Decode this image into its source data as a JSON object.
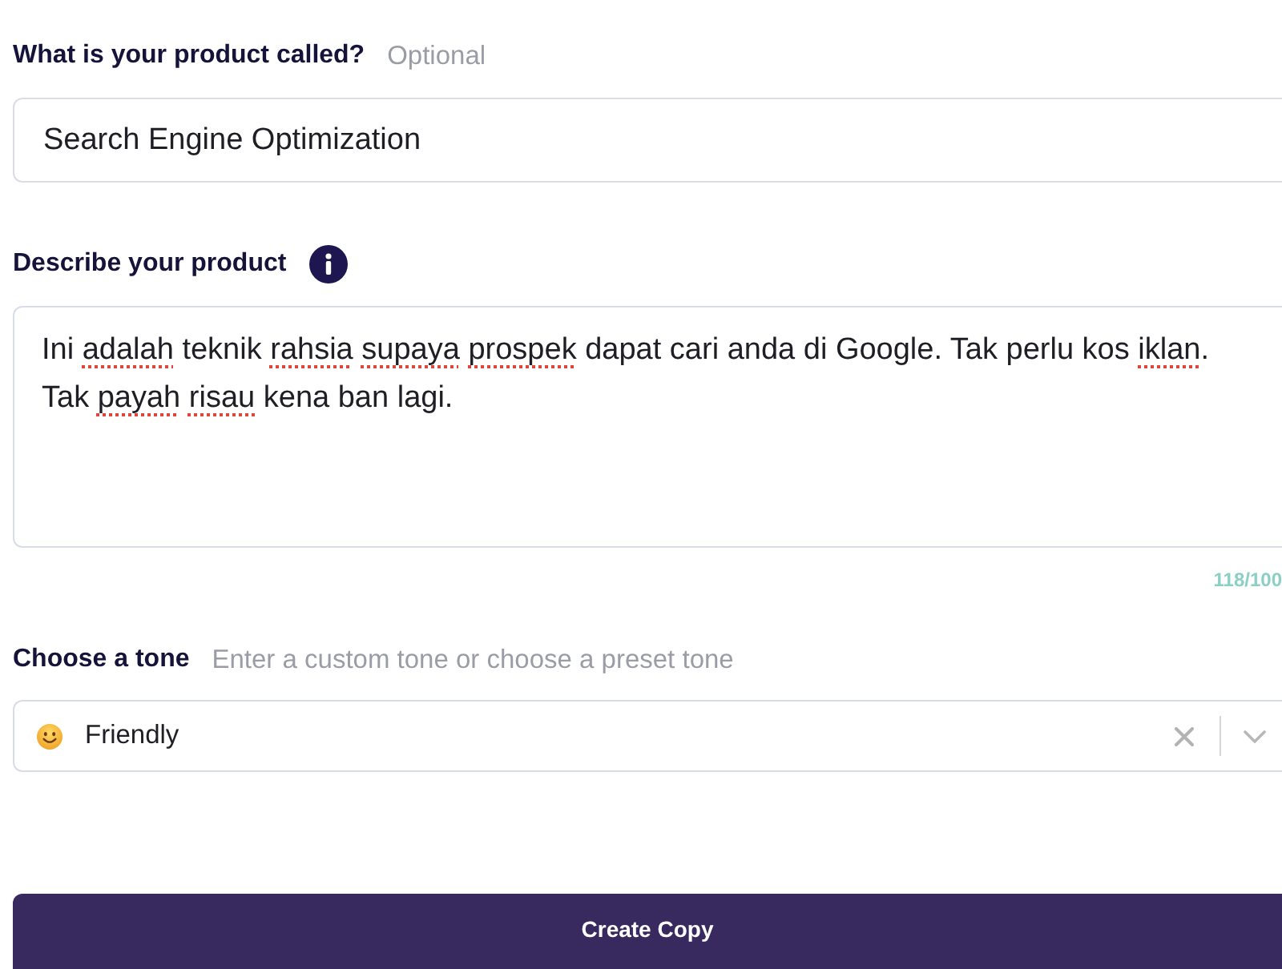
{
  "product_name": {
    "label": "What is your product called?",
    "note": "Optional",
    "value": "Search Engine Optimization"
  },
  "description": {
    "label": "Describe your product",
    "segments": [
      {
        "text": "Ini ",
        "flagged": false
      },
      {
        "text": "adalah",
        "flagged": true
      },
      {
        "text": " teknik ",
        "flagged": false
      },
      {
        "text": "rahsia ",
        "flagged": true
      },
      {
        "text": "supaya ",
        "flagged": true
      },
      {
        "text": "prospek",
        "flagged": true
      },
      {
        "text": " dapat cari anda di Google. Tak perlu kos ",
        "flagged": false
      },
      {
        "text": "iklan",
        "flagged": true
      },
      {
        "text": ".\nTak ",
        "flagged": false
      },
      {
        "text": "payah ",
        "flagged": true
      },
      {
        "text": "risau",
        "flagged": true
      },
      {
        "text": " kena ban lagi.",
        "flagged": false
      }
    ],
    "counter": "118/100"
  },
  "tone": {
    "label": "Choose a tone",
    "helper": "Enter a custom tone or choose a preset tone",
    "value": "Friendly"
  },
  "submit_button": {
    "label": "Create Copy"
  }
}
